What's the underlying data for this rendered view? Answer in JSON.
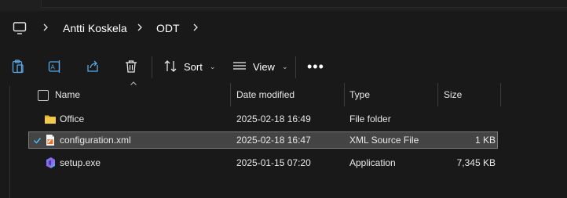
{
  "breadcrumb": {
    "items": [
      "Antti Koskela",
      "ODT"
    ]
  },
  "toolbar": {
    "sort_label": "Sort",
    "view_label": "View"
  },
  "columns": {
    "name": "Name",
    "date_modified": "Date modified",
    "type": "Type",
    "size": "Size"
  },
  "files": [
    {
      "name": "Office",
      "date": "2025-02-18 16:49",
      "type": "File folder",
      "size": "",
      "icon": "folder-icon",
      "selected": false
    },
    {
      "name": "configuration.xml",
      "date": "2025-02-18 16:47",
      "type": "XML Source File",
      "size": "1 KB",
      "icon": "xml-file-icon",
      "selected": true
    },
    {
      "name": "setup.exe",
      "date": "2025-01-15 07:20",
      "type": "Application",
      "size": "7,345 KB",
      "icon": "office-app-icon",
      "selected": false
    }
  ],
  "colors": {
    "background": "#191919",
    "selected_row": "#444444",
    "accent": "#4cc2ff",
    "folder": "#f2c94c"
  }
}
